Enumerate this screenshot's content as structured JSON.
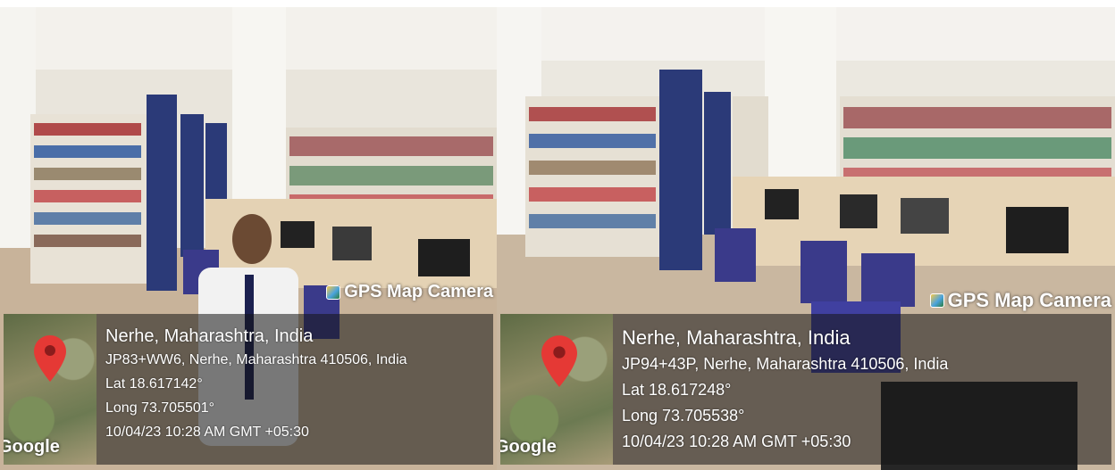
{
  "photos": [
    {
      "overlay_title": "GPS Map Camera",
      "map_brand": "Google",
      "location": "Nerhe, Maharashtra, India",
      "address": "JP83+WW6, Nerhe, Maharashtra 410506, India",
      "latitude": "Lat 18.617142°",
      "longitude": "Long 73.705501°",
      "datetime": "10/04/23 10:28 AM GMT +05:30"
    },
    {
      "overlay_title": "GPS Map Camera",
      "map_brand": "Google",
      "location": "Nerhe, Maharashtra, India",
      "address": "JP94+43P, Nerhe, Maharashtra 410506, India",
      "latitude": "Lat 18.617248°",
      "longitude": "Long 73.705538°",
      "datetime": "10/04/23 10:28 AM GMT +05:30"
    }
  ],
  "colors": {
    "pin": "#e53935",
    "shelf_panel": "#2b3a78"
  }
}
